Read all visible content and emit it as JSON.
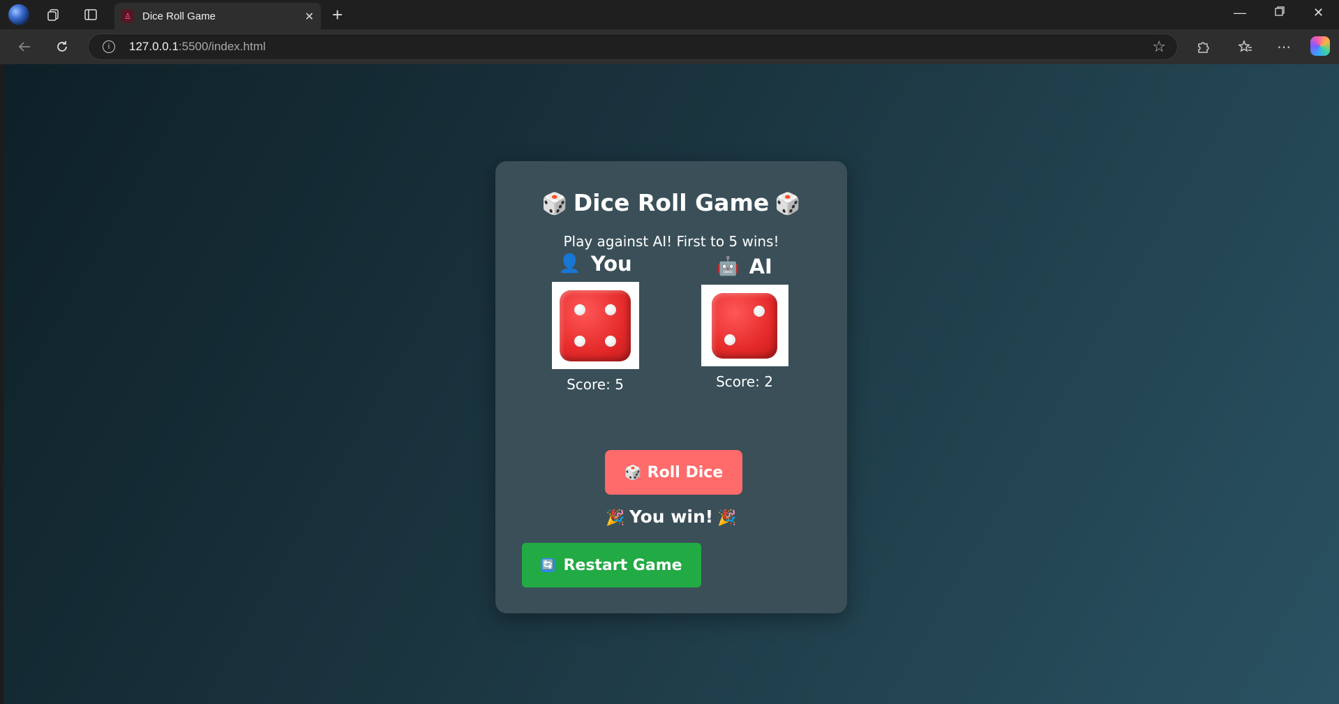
{
  "browser": {
    "tab_title": "Dice Roll Game",
    "url_host": "127.0.0.1",
    "url_rest": ":5500/index.html"
  },
  "game": {
    "title": "Dice Roll Game",
    "title_emoji": "🎲",
    "subtitle": "Play against AI! First to 5 wins!",
    "player": {
      "emoji": "👤",
      "name": "You",
      "die_value": 4,
      "score_text": "Score: 5"
    },
    "ai": {
      "emoji": "🤖",
      "name": "AI",
      "die_value": 2,
      "score_text": "Score: 2"
    },
    "roll_button": {
      "emoji": "🎲",
      "label": "Roll Dice"
    },
    "result": {
      "emoji": "🎉",
      "text": "You win!"
    },
    "restart_button": {
      "emoji": "🔄",
      "label": "Restart Game"
    }
  },
  "colors": {
    "card": "#3a4f58",
    "roll_button": "#ff6b6b",
    "restart_button": "#22aa44",
    "die_red": "#e52a2a"
  }
}
